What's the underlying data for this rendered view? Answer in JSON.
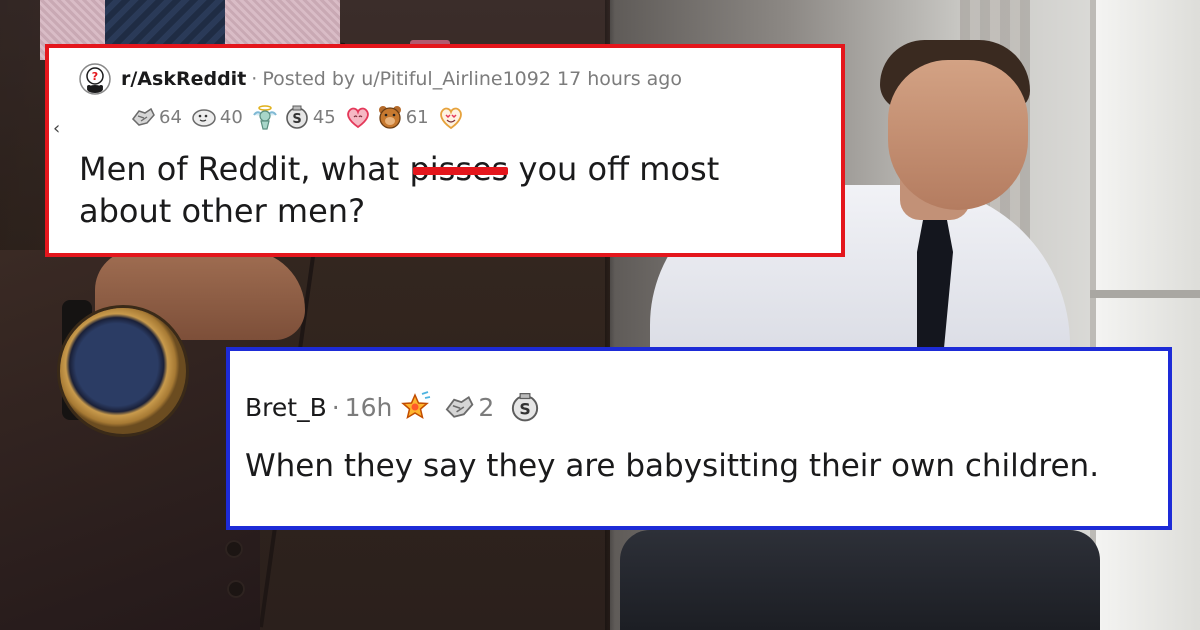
{
  "post": {
    "subreddit": "r/AskReddit",
    "separator": "·",
    "posted_by": "Posted by u/Pitiful_Airline1092 17 hours ago",
    "collapse_glyph": "‹",
    "awards": [
      {
        "icon": "helping-hand-award-icon",
        "count": "64"
      },
      {
        "icon": "wholesome-seal-award-icon",
        "count": "40"
      },
      {
        "icon": "angel-award-icon",
        "count": ""
      },
      {
        "icon": "silver-award-icon",
        "count": "45"
      },
      {
        "icon": "heartwarming-award-icon",
        "count": ""
      },
      {
        "icon": "bear-award-icon",
        "count": "61"
      },
      {
        "icon": "heart-eyes-award-icon",
        "count": ""
      }
    ],
    "title_before": "Men of Reddit, what ",
    "title_censored": "pisses",
    "title_after": " you off most about other men?",
    "accent_color": "#e4161c"
  },
  "comment": {
    "author": "Bret_B",
    "separator": "·",
    "age": "16h",
    "awards": [
      {
        "icon": "starstruck-award-icon",
        "count": ""
      },
      {
        "icon": "helping-hand-award-icon",
        "count": "2"
      },
      {
        "icon": "silver-award-icon",
        "count": ""
      }
    ],
    "body": "When they say they are babysitting their own children.",
    "accent_color": "#1d2bd7"
  }
}
